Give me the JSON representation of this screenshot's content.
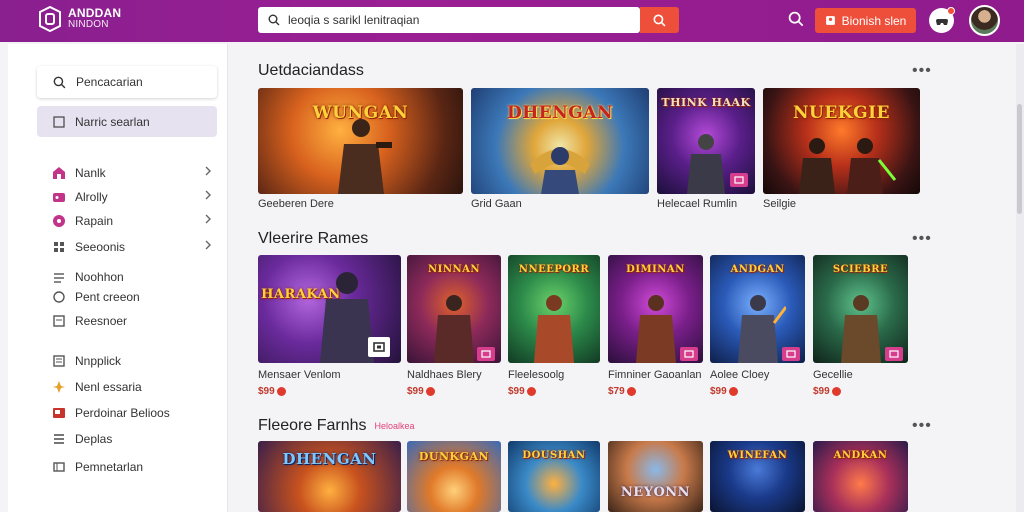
{
  "app": {
    "logo_line1": "ANDDAN",
    "logo_line2": "NINDON"
  },
  "header": {
    "search_value": "leoqia s sarikl lenitraqian",
    "signup_label": "Bionish slen"
  },
  "sidebar": {
    "search_label": "Pencacarian",
    "active_label": "Narric searlan",
    "groups": [
      {
        "items": [
          {
            "label": "Nanlk",
            "icon": "home-icon",
            "color": "#c2338a",
            "chevron": true
          },
          {
            "label": "Alrolly",
            "icon": "gamepad-icon",
            "color": "#c2338a",
            "chevron": true
          },
          {
            "label": "Rapain",
            "icon": "tag-icon",
            "color": "#c2338a",
            "chevron": true
          },
          {
            "label": "Seeoonis",
            "icon": "grid-icon",
            "color": "#555555",
            "chevron": true
          }
        ]
      },
      {
        "items": [
          {
            "label": "Noohhon",
            "icon": "lines-icon",
            "color": "#555555"
          },
          {
            "label": "Pent creeon",
            "icon": "circle-icon",
            "color": "#555555"
          },
          {
            "label": "Reesnoer",
            "icon": "note-icon",
            "color": "#555555"
          }
        ]
      },
      {
        "items": [
          {
            "label": "Nnpplick",
            "icon": "list-icon",
            "color": "#555555"
          },
          {
            "label": "Nenl essaria",
            "icon": "spark-icon",
            "color": "#e6a12d"
          },
          {
            "label": "Perdoinar Belioos",
            "icon": "box-icon",
            "color": "#c8342b"
          },
          {
            "label": "Deplas",
            "icon": "stack-icon",
            "color": "#555555"
          },
          {
            "label": "Pemnetarlan",
            "icon": "panel-icon",
            "color": "#555555"
          }
        ]
      }
    ]
  },
  "sections": [
    {
      "title": "Uetdaciandass",
      "more": "•••",
      "cards": [
        {
          "label": "Geeberen Dere",
          "art": "WUNGAN"
        },
        {
          "label": "Grid Gaan",
          "art": "DHENGAN"
        },
        {
          "label": "Helecael Rumlin",
          "art": "THINK HAAK"
        },
        {
          "label": "Seilgie",
          "art": "NUEKGIE"
        }
      ]
    },
    {
      "title": "Vleerire Rames",
      "more": "•••",
      "cards": [
        {
          "label": "Mensaer Venlom",
          "price": "$99",
          "art": "HARAKAN"
        },
        {
          "label": "Naldhaes Blery",
          "price": "$99",
          "art": "NINNAN"
        },
        {
          "label": "Fleelesoolg",
          "price": "$99",
          "art": "NNEEPORR"
        },
        {
          "label": "Fimniner Gaoanlan",
          "price": "$79",
          "art": "DIMINAN"
        },
        {
          "label": "Aolee Cloey",
          "price": "$99",
          "art": "ANDGAN"
        },
        {
          "label": "Gecellie",
          "price": "$99",
          "art": "SCIEBRE"
        }
      ]
    },
    {
      "title": "Fleeore Farnhs",
      "tag": "Heloalkea",
      "more": "•••",
      "cards": [
        {
          "art": "DHENGAN"
        },
        {
          "art": "DUNKGAN"
        },
        {
          "art": "DOUSHAN"
        },
        {
          "art": "NEYONN"
        },
        {
          "art": "WINEFAN"
        },
        {
          "art": "ANDKAN"
        }
      ]
    }
  ],
  "colors": {
    "header": "#8f1b8c",
    "accent": "#ee4f3a",
    "sidebar_active": "#e7e2f0"
  }
}
